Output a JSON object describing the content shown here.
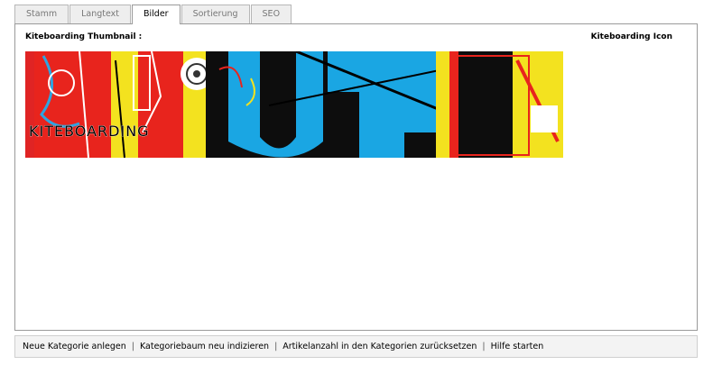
{
  "tabs": [
    {
      "label": "Stamm",
      "active": false
    },
    {
      "label": "Langtext",
      "active": false
    },
    {
      "label": "Bilder",
      "active": true
    },
    {
      "label": "Sortierung",
      "active": false
    },
    {
      "label": "SEO",
      "active": false
    }
  ],
  "panel": {
    "thumbnail_label": "Kiteboarding Thumbnail :",
    "icon_label": "Kiteboarding Icon",
    "banner_text": "KITEBOARDING"
  },
  "footer": {
    "links": [
      "Neue Kategorie anlegen",
      "Kategoriebaum neu indizieren",
      "Artikelanzahl in den Kategorien zurücksetzen",
      "Hilfe starten"
    ],
    "separator": "|"
  }
}
